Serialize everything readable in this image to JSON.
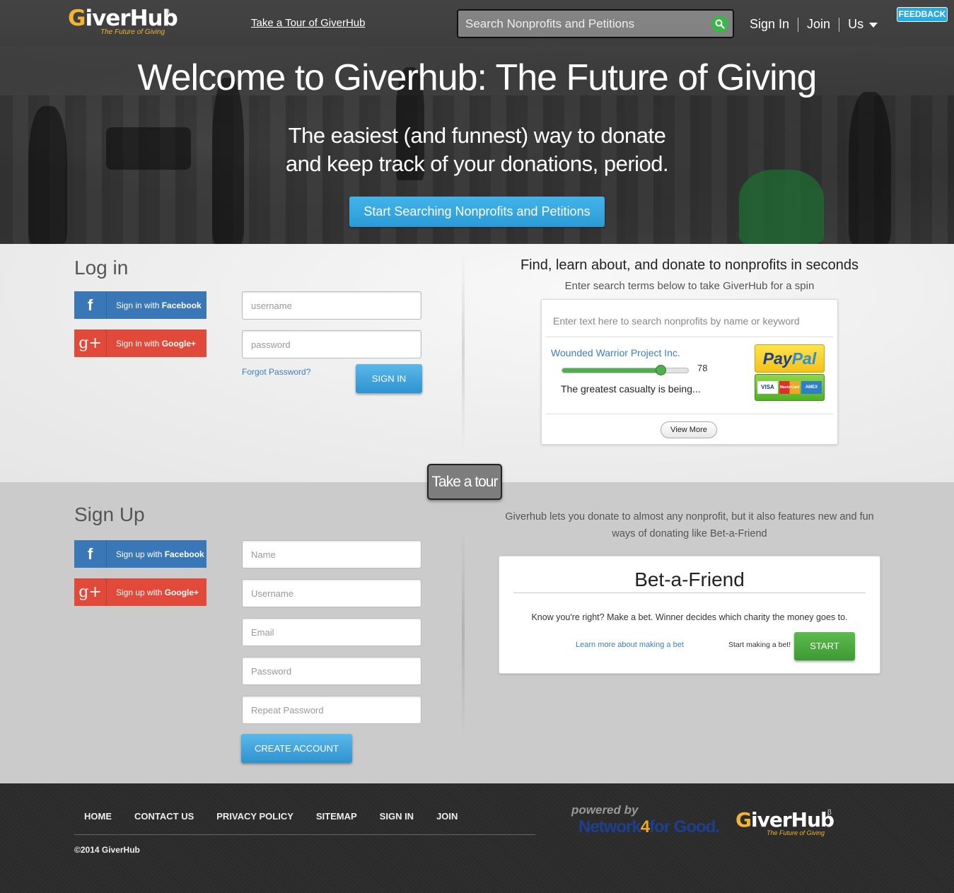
{
  "header": {
    "logo": {
      "word_first": "G",
      "word_rest": "iverHub",
      "tagline": "The Future of Giving",
      "beta": "β"
    },
    "tour_link": "Take a Tour of GiverHub",
    "search": {
      "placeholder": "Search Nonprofits and Petitions"
    },
    "nav": {
      "sign_in": "Sign In",
      "join": "Join",
      "us": "Us"
    },
    "feedback": "FEEDBACK"
  },
  "hero": {
    "title": "Welcome to Giverhub: The Future of Giving",
    "sub_line1": "The easiest (and funnest) way to donate",
    "sub_line2": "and keep track of your donations, period.",
    "cta": "Start Searching Nonprofits and Petitions"
  },
  "login": {
    "title": "Log in",
    "fb_prefix": "Sign in with ",
    "fb_brand": "Facebook",
    "gp_prefix": "Sign in with ",
    "gp_brand": "Google+",
    "username_placeholder": "username",
    "password_placeholder": "password",
    "forgot": "Forgot Password?",
    "sign_in_btn": "SIGN IN"
  },
  "find": {
    "title": "Find, learn about, and donate to nonprofits in seconds",
    "subtitle": "Enter search terms below to take GiverHub for a spin",
    "search_placeholder": "Enter text here to search nonprofits by name or keyword",
    "result": {
      "name": "Wounded Warrior Project Inc.",
      "score": 78,
      "score_max": 100,
      "description": "The greatest casualty is being..."
    },
    "paypal_1": "Pay",
    "paypal_2": "Pal",
    "cards": [
      "VISA",
      "MasterCard",
      "AMEX"
    ],
    "view_more": "View More"
  },
  "take_tour": "Take a tour",
  "signup": {
    "title": "Sign Up",
    "fb_prefix": "Sign up with ",
    "fb_brand": "Facebook",
    "gp_prefix": "Sign up with ",
    "gp_brand": "Google+",
    "name_placeholder": "Name",
    "username_placeholder": "Username",
    "email_placeholder": "Email",
    "password_placeholder": "Password",
    "repeat_placeholder": "Repeat Password",
    "create_btn": "CREATE ACCOUNT"
  },
  "bet": {
    "intro": "Giverhub lets you donate to almost any nonprofit, but it also features new and fun ways of donating like Bet-a-Friend",
    "title": "Bet-a-Friend",
    "desc": "Know you're right? Make a bet. Winner decides which charity the money goes to.",
    "learn": "Learn more about making a bet",
    "start_text": "Start making a bet!",
    "start_btn": "START"
  },
  "footer": {
    "nav": [
      "HOME",
      "CONTACT US",
      "PRIVACY POLICY",
      "SITEMAP",
      "SIGN IN",
      "JOIN"
    ],
    "copyright": "©2014 GiverHub",
    "powered_by": "powered by",
    "nfg_1": "Network",
    "nfg_2": "4",
    "nfg_3": "for Good."
  },
  "colors": {
    "accent_blue": "#2a9bd6",
    "facebook": "#3a77b6",
    "google": "#e14a3a",
    "green": "#4fae4d",
    "logo_gold": "#f2b531"
  }
}
